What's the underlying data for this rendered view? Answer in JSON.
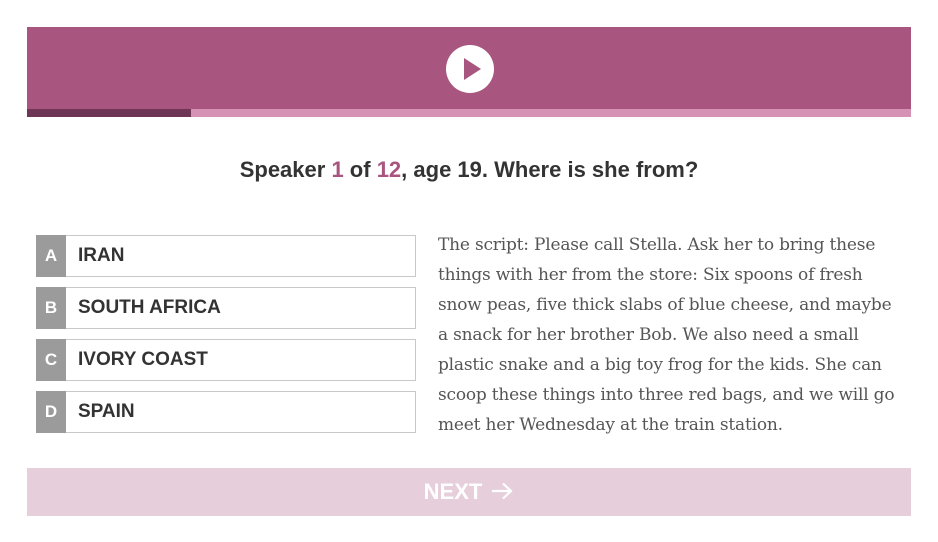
{
  "colors": {
    "accent": "#a8567f",
    "progress_track": "#d592b5",
    "progress_fill": "#6e3654",
    "next_bg": "#e6cedb",
    "letter_bg": "#9b9b9b"
  },
  "player": {
    "play_icon": "play-icon",
    "progress_fraction": 0.185
  },
  "question": {
    "prefix": "Speaker ",
    "current": "1",
    "of_text": " of ",
    "total": "12",
    "suffix": ", age 19. Where is she from?"
  },
  "options": [
    {
      "letter": "A",
      "label": "IRAN"
    },
    {
      "letter": "B",
      "label": "SOUTH AFRICA"
    },
    {
      "letter": "C",
      "label": "IVORY COAST"
    },
    {
      "letter": "D",
      "label": "SPAIN"
    }
  ],
  "script": {
    "text": "The script: Please call Stella. Ask her to bring these things with her from the store: Six spoons of fresh snow peas, five thick slabs of blue cheese, and maybe a snack for her brother Bob. We also need a small plastic snake and a big toy frog for the kids. She can scoop these things into three red bags, and we will go meet her Wednesday at the train station."
  },
  "next": {
    "label": "NEXT",
    "icon": "arrow-right-icon"
  }
}
